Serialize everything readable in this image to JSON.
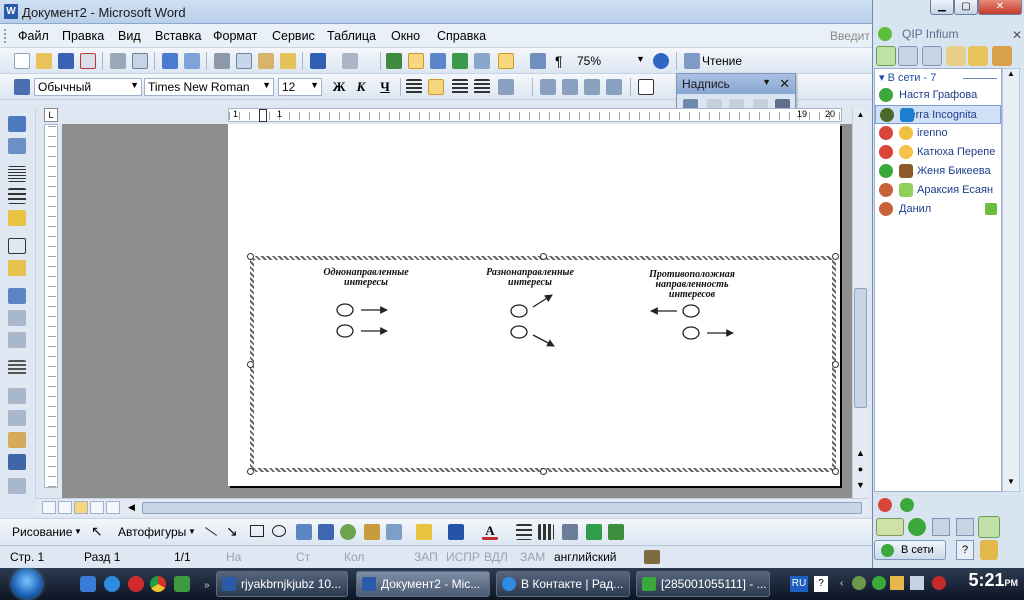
{
  "word": {
    "title": "Документ2 - Microsoft Word",
    "title_icon_letter": "W",
    "menu": [
      "Файл",
      "Правка",
      "Вид",
      "Вставка",
      "Формат",
      "Сервис",
      "Таблица",
      "Окно",
      "Справка"
    ],
    "menu_right": "Введит",
    "zoom": "75%",
    "reading_label": "Чтение",
    "style": "Обычный",
    "font": "Times New Roman",
    "size": "12",
    "bold": "Ж",
    "italic": "К",
    "underline": "Ч",
    "nadpis_title": "Надпись",
    "ruler_corner": "L",
    "ruler_numbers": [
      "1",
      "2",
      "1",
      "19",
      "20"
    ],
    "diagram": {
      "col1": [
        "Однонаправленные",
        "интересы"
      ],
      "col2": [
        "Разнонаправленные",
        "интересы"
      ],
      "col3": [
        "Противоположная",
        "направленность",
        "интересов"
      ]
    },
    "draw_label": "Рисование",
    "autoshapes_label": "Автофигуры",
    "status": {
      "page": "Стр. 1",
      "section": "Разд 1",
      "pages": "1/1",
      "at": "На",
      "line": "Ст",
      "col": "Кол",
      "rec": "ЗАП",
      "trk": "ИСПР",
      "ext": "ВДЛ",
      "ovr": "ЗАМ",
      "lang": "английский"
    }
  },
  "qip": {
    "title": "QIP Infium",
    "group": "В сети - 7",
    "contacts": [
      {
        "name": "Настя Графова",
        "selected": false
      },
      {
        "name": "Terra Incognita",
        "selected": true
      },
      {
        "name": "irenno",
        "selected": false
      },
      {
        "name": "Катюха Перепе",
        "selected": false
      },
      {
        "name": "Женя Бикеева",
        "selected": false
      },
      {
        "name": "Араксия Есаян",
        "selected": false
      },
      {
        "name": "Данил",
        "selected": false
      }
    ],
    "status_button": "В сети"
  },
  "taskbar": {
    "tasks": [
      {
        "label": "rjyakbrnjkjubz 10...",
        "active": false
      },
      {
        "label": "Документ2 - Mic...",
        "active": true
      },
      {
        "label": "В Контакте | Рад...",
        "active": false
      },
      {
        "label": "[285001055111] - ...",
        "active": false
      }
    ],
    "lang": "RU",
    "clock": "5:21",
    "ampm": "PM"
  },
  "colors": {
    "word_blue": "#2b5aa8",
    "qip_green": "#3aa83a",
    "taskbar": "#1b2638"
  }
}
